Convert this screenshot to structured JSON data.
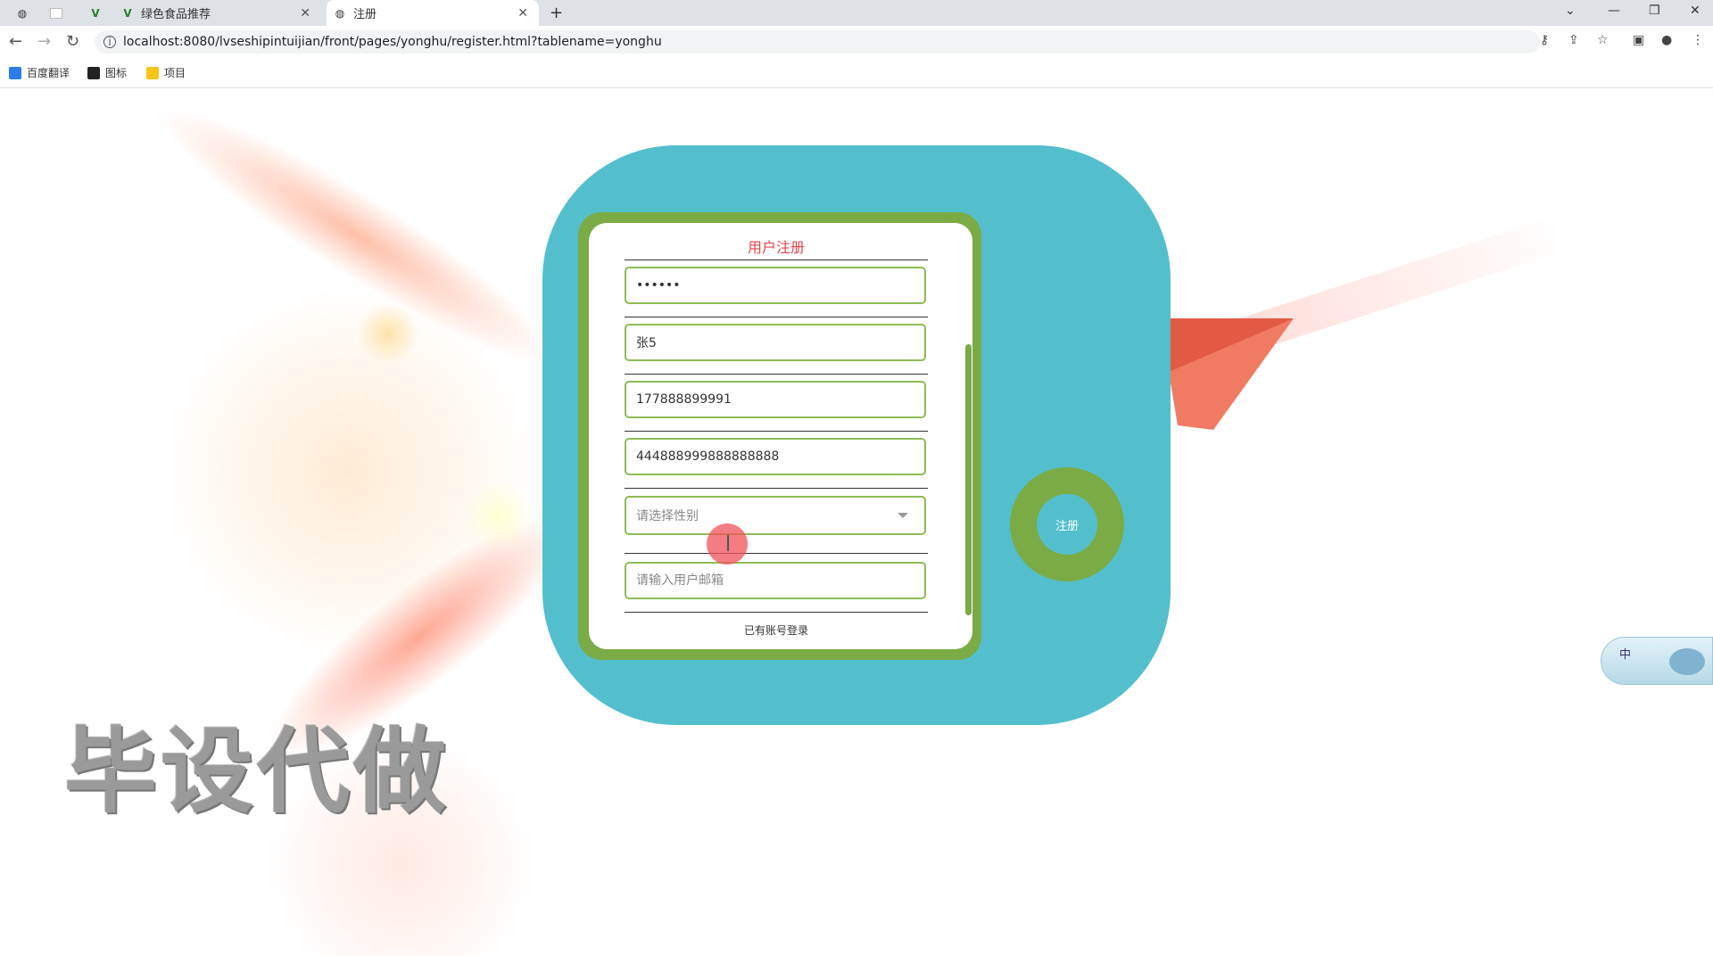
{
  "browser": {
    "tabs": [
      {
        "title": "",
        "icon": "globe-icon",
        "active": false
      },
      {
        "title": "",
        "icon": "blank-page-icon",
        "active": false
      },
      {
        "title": "",
        "icon": "vue-logo-icon",
        "active": false
      },
      {
        "title": "绿色食品推荐",
        "icon": "vue-logo-icon",
        "active": false
      },
      {
        "title": "注册",
        "icon": "globe-icon",
        "active": true
      }
    ],
    "url": "localhost:8080/lvseshipintuijian/front/pages/yonghu/register.html?tablename=yonghu",
    "bookmarks": [
      {
        "label": "百度翻译",
        "icon": "translate-icon"
      },
      {
        "label": "图标",
        "icon": "image-icon"
      },
      {
        "label": "项目",
        "icon": "folder-icon"
      }
    ]
  },
  "form": {
    "title": "用户注册",
    "password_value": "••••••",
    "name_value": "张5",
    "phone_value": "177888899991",
    "id_value": "444888999888888888",
    "gender_placeholder": "请选择性别",
    "email_placeholder": "请输入用户邮箱",
    "login_link": "已有账号登录"
  },
  "register_button": {
    "label": "注册"
  },
  "watermark": "毕设代做",
  "ime_widget": {
    "label": "中"
  },
  "colors": {
    "teal": "#54bfcc",
    "green": "#7aab45",
    "title_red": "#e2454e",
    "field_border": "#8ebc56"
  }
}
